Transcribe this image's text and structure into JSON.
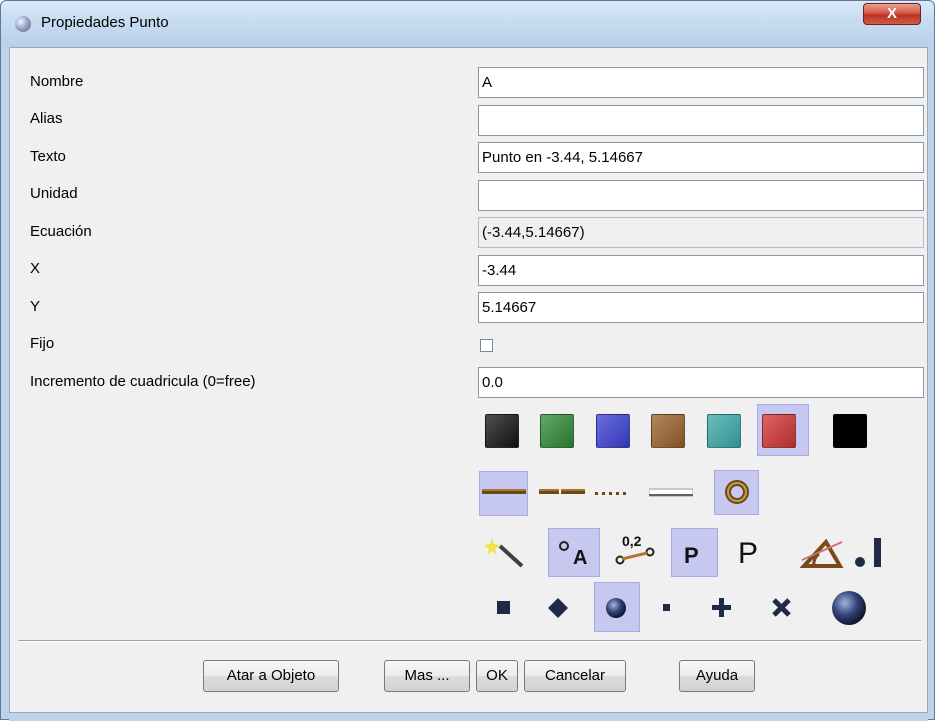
{
  "window": {
    "title": "Propiedades Punto",
    "close_label": "X"
  },
  "form": {
    "rows": [
      {
        "label": "Nombre",
        "value": ""
      },
      {
        "label": "Alias"
      },
      {
        "label": "Texto"
      },
      {
        "label": "Unidad"
      },
      {
        "label": "Ecuación"
      },
      {
        "label": "X"
      },
      {
        "label": "Y"
      },
      {
        "label": "Fijo"
      },
      {
        "label": "Incremento de cuadricula (0=free)"
      }
    ],
    "values": {
      "nombre": "A",
      "alias": "",
      "texto": "Punto en -3.44, 5.14667",
      "unidad": "",
      "ecuacion": "(-3.44,5.14667)",
      "x": "-3.44",
      "y": "5.14667",
      "fijo_checked": false,
      "incremento": "0.0"
    }
  },
  "palette": {
    "colors": [
      "#141414",
      "#2e8a36",
      "#3a3fd6",
      "#9a6028",
      "#3aa9a8",
      "#d13330",
      "#000000"
    ],
    "selected_color_index": 5,
    "selected_line_style_index": 0,
    "selected_label_mode_index": 1,
    "selected_point_style_index": 2,
    "icons": {
      "line_styles": [
        "solid-line-icon",
        "dashed-line-icon",
        "dotted-line-icon",
        "thin-line-icon",
        "ring-icon"
      ],
      "label_modes": [
        "magic-wand-icon",
        "point-label-icon",
        "coordinate-label-icon",
        "bold-p-icon",
        "plain-p-icon",
        "angle-icon",
        "bar-point-icon"
      ],
      "point_styles": [
        "square-point-icon",
        "diamond-point-icon",
        "ball-point-icon",
        "tiny-dot-icon",
        "plus-point-icon",
        "cross-point-icon",
        "large-ball-icon"
      ]
    },
    "label_texts": {
      "coordinate": "0,2",
      "point_label": "A",
      "bold_p": "P",
      "plain_p": "P"
    }
  },
  "buttons": {
    "atar": "Atar a Objeto",
    "mas": "Mas ...",
    "ok": "OK",
    "cancelar": "Cancelar",
    "ayuda": "Ayuda"
  }
}
